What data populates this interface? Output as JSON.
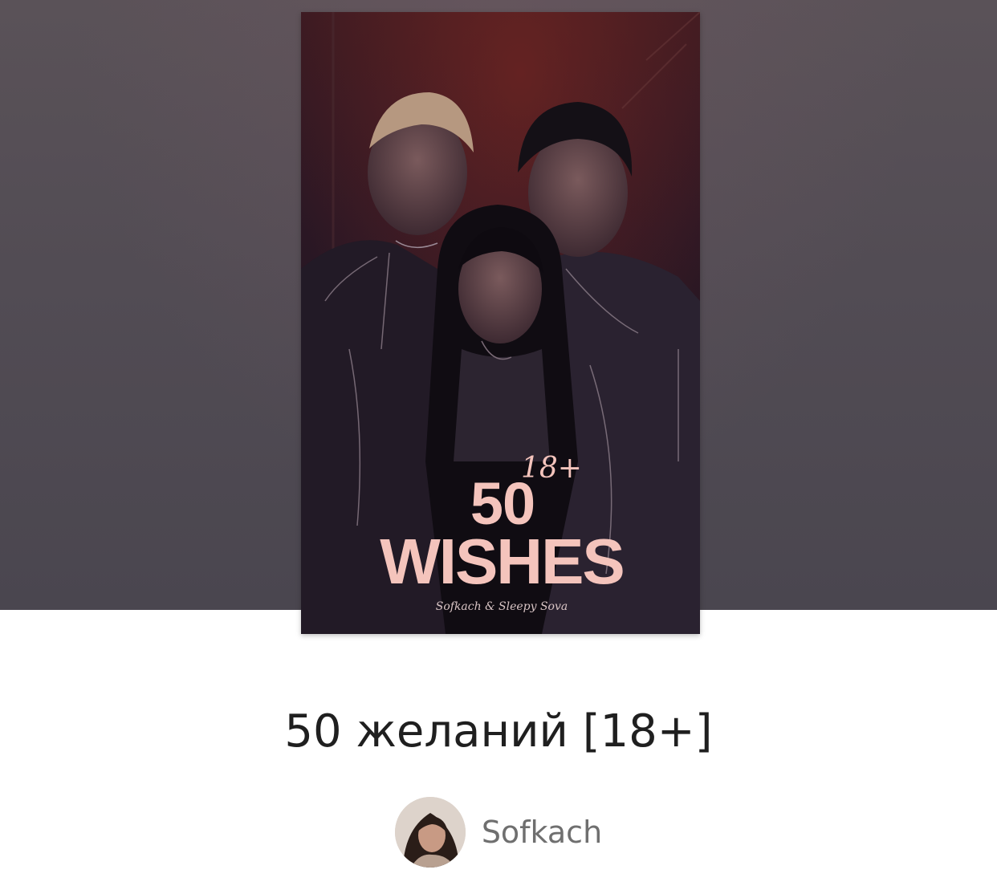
{
  "cover": {
    "number_text": "50",
    "age_mark": "18+",
    "title_word": "WISHES",
    "credits": "Sofkach & Sleepy Sova"
  },
  "story": {
    "title": "50 желаний [18+]"
  },
  "author": {
    "name": "Sofkach"
  },
  "colors": {
    "hero_background": "#524c54",
    "cover_title": "#f4c4bc",
    "title_text": "#1f1f1f",
    "author_text": "#6f6f6f"
  }
}
